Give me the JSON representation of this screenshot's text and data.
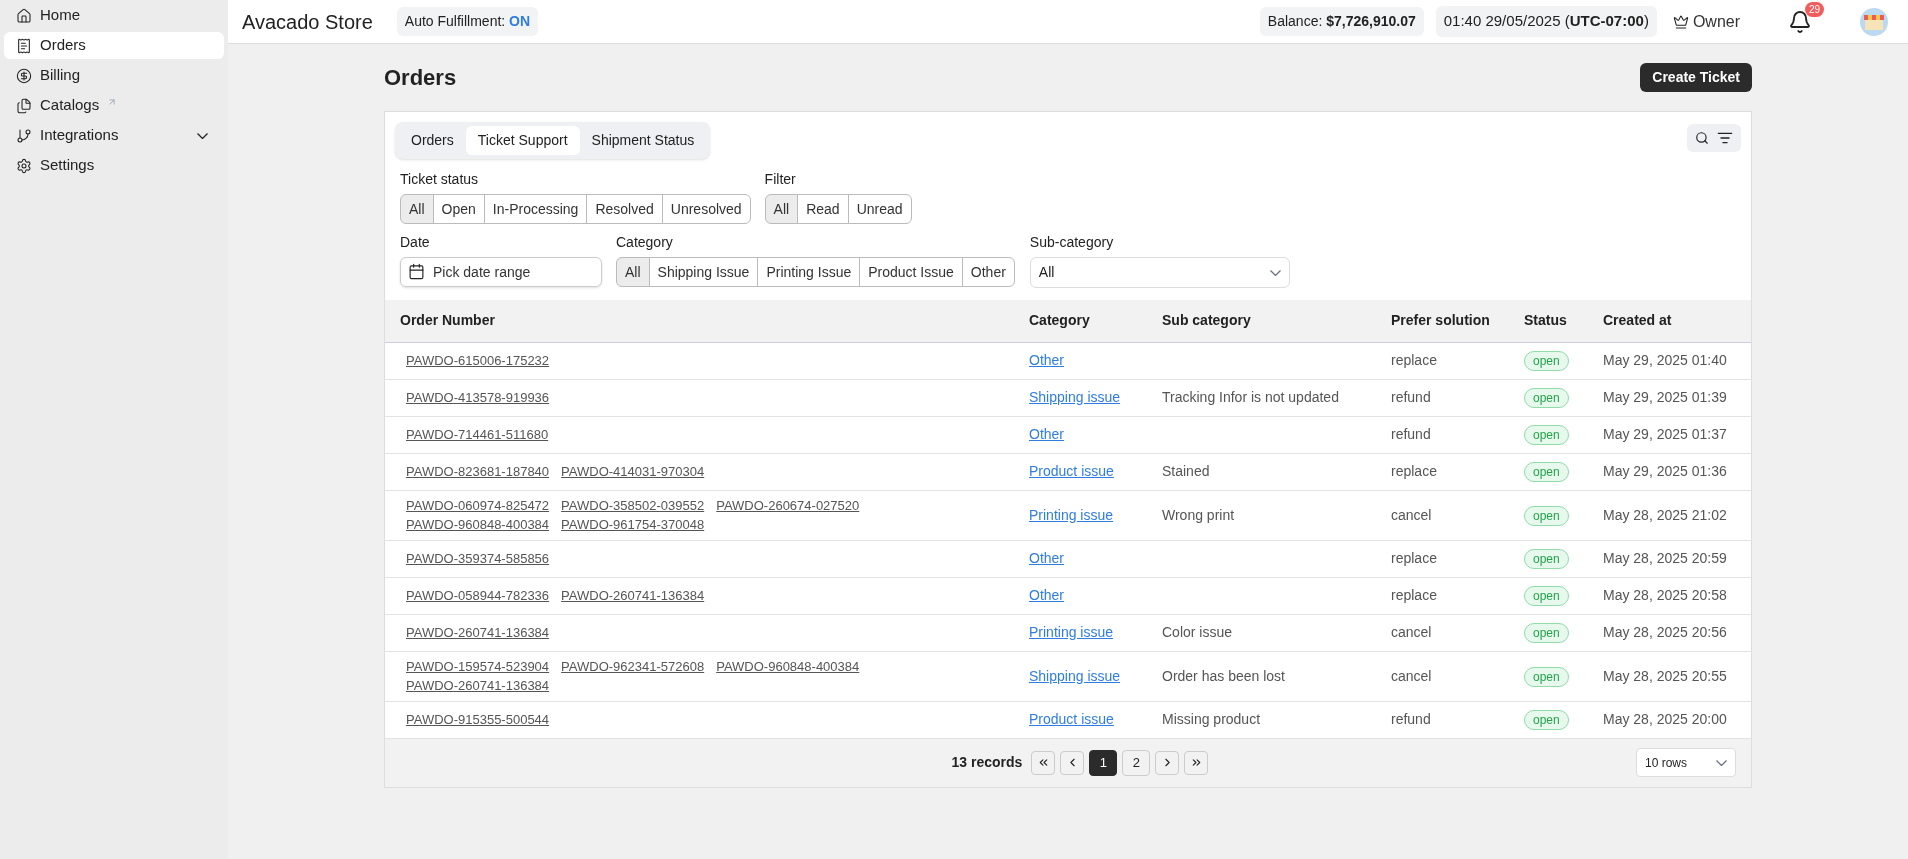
{
  "sidebar": {
    "items": [
      {
        "label": "Home",
        "selected": false,
        "external": false,
        "expandable": false
      },
      {
        "label": "Orders",
        "selected": true,
        "external": false,
        "expandable": false
      },
      {
        "label": "Billing",
        "selected": false,
        "external": false,
        "expandable": false
      },
      {
        "label": "Catalogs",
        "selected": false,
        "external": true,
        "expandable": false
      },
      {
        "label": "Integrations",
        "selected": false,
        "external": false,
        "expandable": true
      },
      {
        "label": "Settings",
        "selected": false,
        "external": false,
        "expandable": false
      }
    ]
  },
  "header": {
    "store_name": "Avacado Store",
    "auto_fulfillment": {
      "label": "Auto Fulfillment:",
      "value": "ON"
    },
    "balance": {
      "label": "Balance:",
      "value": "$7,726,910.07"
    },
    "clock": "01:40 29/05/2025 (**UTC-07:00**)",
    "role": "Owner",
    "notifications": "29"
  },
  "page": {
    "title": "Orders",
    "create_button": "Create Ticket"
  },
  "tabs": [
    {
      "label": "Orders",
      "selected": false
    },
    {
      "label": "Ticket Support",
      "selected": true
    },
    {
      "label": "Shipment Status",
      "selected": false
    }
  ],
  "filters": {
    "ticket_status": {
      "label": "Ticket status",
      "options": [
        {
          "label": "All",
          "selected": true
        },
        {
          "label": "Open",
          "selected": false
        },
        {
          "label": "In-Processing",
          "selected": false
        },
        {
          "label": "Resolved",
          "selected": false
        },
        {
          "label": "Unresolved",
          "selected": false
        }
      ]
    },
    "filter": {
      "label": "Filter",
      "options": [
        {
          "label": "All",
          "selected": true
        },
        {
          "label": "Read",
          "selected": false
        },
        {
          "label": "Unread",
          "selected": false
        }
      ]
    },
    "date": {
      "label": "Date",
      "placeholder": "Pick date range"
    },
    "category": {
      "label": "Category",
      "options": [
        {
          "label": "All",
          "selected": true
        },
        {
          "label": "Shipping Issue",
          "selected": false
        },
        {
          "label": "Printing Issue",
          "selected": false
        },
        {
          "label": "Product Issue",
          "selected": false
        },
        {
          "label": "Other",
          "selected": false
        }
      ]
    },
    "sub_category": {
      "label": "Sub-category",
      "value": "All"
    }
  },
  "table": {
    "columns": [
      "Order Number",
      "Category",
      "Sub category",
      "Prefer solution",
      "Status",
      "Created at"
    ],
    "rows": [
      {
        "orders": [
          "PAWDO-615006-175232"
        ],
        "category": "Other",
        "sub_category": "",
        "solution": "replace",
        "status": "open",
        "created": "May 29, 2025 01:40"
      },
      {
        "orders": [
          "PAWDO-413578-919936"
        ],
        "category": "Shipping issue",
        "sub_category": "Tracking Infor is not updated",
        "solution": "refund",
        "status": "open",
        "created": "May 29, 2025 01:39"
      },
      {
        "orders": [
          "PAWDO-714461-511680"
        ],
        "category": "Other",
        "sub_category": "",
        "solution": "refund",
        "status": "open",
        "created": "May 29, 2025 01:37"
      },
      {
        "orders": [
          "PAWDO-823681-187840",
          "PAWDO-414031-970304"
        ],
        "category": "Product issue",
        "sub_category": "Stained",
        "solution": "replace",
        "status": "open",
        "created": "May 29, 2025 01:36"
      },
      {
        "orders": [
          "PAWDO-060974-825472",
          "PAWDO-358502-039552",
          "PAWDO-260674-027520",
          "PAWDO-960848-400384",
          "PAWDO-961754-370048"
        ],
        "category": "Printing issue",
        "sub_category": "Wrong print",
        "solution": "cancel",
        "status": "open",
        "created": "May 28, 2025 21:02"
      },
      {
        "orders": [
          "PAWDO-359374-585856"
        ],
        "category": "Other",
        "sub_category": "",
        "solution": "replace",
        "status": "open",
        "created": "May 28, 2025 20:59"
      },
      {
        "orders": [
          "PAWDO-058944-782336",
          "PAWDO-260741-136384"
        ],
        "category": "Other",
        "sub_category": "",
        "solution": "replace",
        "status": "open",
        "created": "May 28, 2025 20:58"
      },
      {
        "orders": [
          "PAWDO-260741-136384"
        ],
        "category": "Printing issue",
        "sub_category": "Color issue",
        "solution": "cancel",
        "status": "open",
        "created": "May 28, 2025 20:56"
      },
      {
        "orders": [
          "PAWDO-159574-523904",
          "PAWDO-962341-572608",
          "PAWDO-960848-400384",
          "PAWDO-260741-136384"
        ],
        "category": "Shipping issue",
        "sub_category": "Order has been lost",
        "solution": "cancel",
        "status": "open",
        "created": "May 28, 2025 20:55"
      },
      {
        "orders": [
          "PAWDO-915355-500544"
        ],
        "category": "Product issue",
        "sub_category": "Missing product",
        "solution": "refund",
        "status": "open",
        "created": "May 28, 2025 20:00"
      }
    ]
  },
  "pagination": {
    "records": "13 records",
    "pages": [
      {
        "label": "1",
        "selected": true
      },
      {
        "label": "2",
        "selected": false
      }
    ],
    "page_size": "10 rows"
  }
}
